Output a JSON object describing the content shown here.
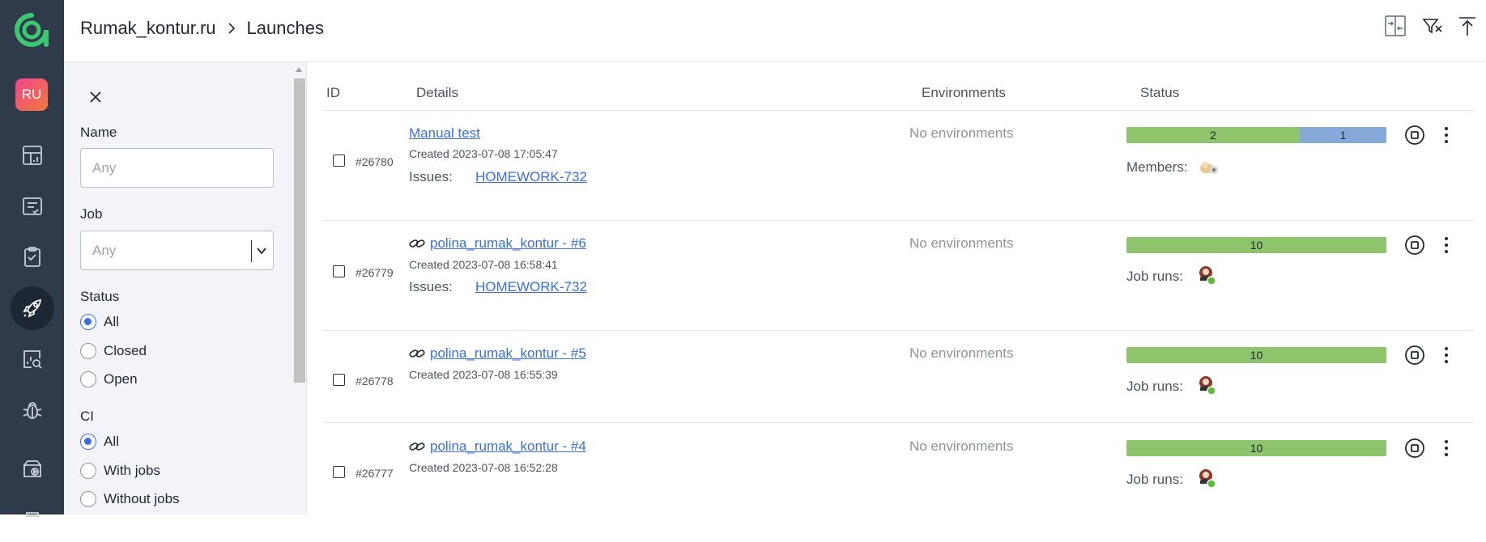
{
  "breadcrumb": {
    "project": "Rumak_kontur.ru",
    "page": "Launches"
  },
  "user": {
    "initials": "RU"
  },
  "nav": {
    "items": [
      {
        "icon": "dashboard-icon"
      },
      {
        "icon": "test-cases-icon"
      },
      {
        "icon": "test-plans-icon"
      },
      {
        "icon": "launches-rocket-icon",
        "active": true
      },
      {
        "icon": "analytics-icon"
      },
      {
        "icon": "defects-bug-icon"
      },
      {
        "icon": "jobs-icon"
      }
    ]
  },
  "header_icons": [
    "compare-icon",
    "clear-filter-icon",
    "upload-icon"
  ],
  "filter": {
    "name_label": "Name",
    "name_placeholder": "Any",
    "job_label": "Job",
    "job_placeholder": "Any",
    "status_label": "Status",
    "status_options": [
      {
        "label": "All",
        "selected": true
      },
      {
        "label": "Closed",
        "selected": false
      },
      {
        "label": "Open",
        "selected": false
      }
    ],
    "ci_label": "CI",
    "ci_options": [
      {
        "label": "All",
        "selected": true
      },
      {
        "label": "With jobs",
        "selected": false
      },
      {
        "label": "Without jobs",
        "selected": false
      }
    ]
  },
  "table": {
    "columns": {
      "id": "ID",
      "details": "Details",
      "environments": "Environments",
      "status": "Status"
    },
    "rows": [
      {
        "id": "#26780",
        "title": "Manual test",
        "has_link_icon": false,
        "created": "Created 2023-07-08 17:05:47",
        "issues_label": "Issues:",
        "issue": "HOMEWORK-732",
        "environments": "No environments",
        "bar": [
          {
            "value": 2,
            "label": "2",
            "color": "#8ec56c"
          },
          {
            "value": 1,
            "label": "1",
            "color": "#85a9d8"
          }
        ],
        "members_label": "Members:"
      },
      {
        "id": "#26779",
        "title": "polina_rumak_kontur - #6",
        "has_link_icon": true,
        "created": "Created 2023-07-08 16:58:41",
        "issues_label": "Issues:",
        "issue": "HOMEWORK-732",
        "environments": "No environments",
        "bar": [
          {
            "value": 10,
            "label": "10",
            "color": "#8ec56c"
          }
        ],
        "members_label": "Job runs:"
      },
      {
        "id": "#26778",
        "title": "polina_rumak_kontur - #5",
        "has_link_icon": true,
        "created": "Created 2023-07-08 16:55:39",
        "environments": "No environments",
        "bar": [
          {
            "value": 10,
            "label": "10",
            "color": "#8ec56c"
          }
        ],
        "members_label": "Job runs:"
      },
      {
        "id": "#26777",
        "title": "polina_rumak_kontur - #4",
        "has_link_icon": true,
        "created": "Created 2023-07-08 16:52:28",
        "environments": "No environments",
        "bar": [
          {
            "value": 10,
            "label": "10",
            "color": "#8ec56c"
          }
        ],
        "members_label": "Job runs:"
      }
    ]
  },
  "colors": {
    "rail": "#2f3b4b",
    "accent": "#3a6fd8",
    "passed": "#8ec56c",
    "unknown": "#85a9d8",
    "logo": "#3cc872"
  }
}
